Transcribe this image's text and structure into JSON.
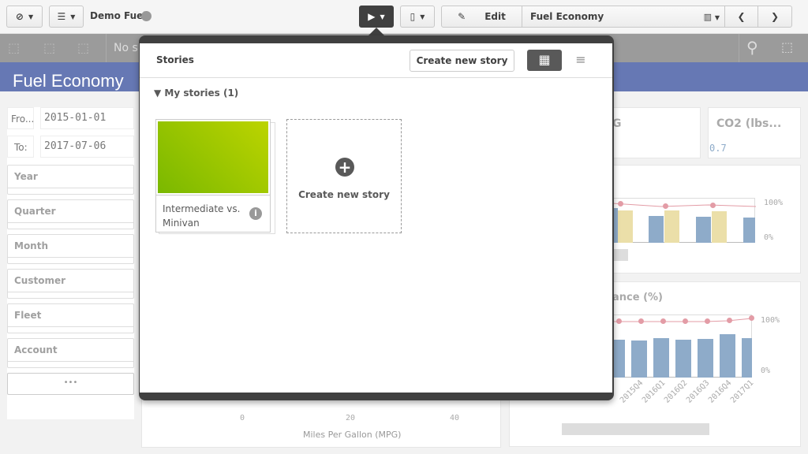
{
  "toolbar": {
    "app_name": "Demo Fuel",
    "edit_label": "Edit",
    "sheet_name": "Fuel Economy"
  },
  "selections": {
    "text": "No s"
  },
  "sheet": {
    "title": "Fuel Economy"
  },
  "filters": {
    "from_label": "Fro...",
    "from_value": "2015-01-01",
    "to_label": "To:",
    "to_value": "2017-07-06",
    "items": [
      "Year",
      "Quarter",
      "Month",
      "Customer",
      "Fleet",
      "Account"
    ],
    "more": "•••"
  },
  "kpis": [
    {
      "title": "G"
    },
    {
      "title": "CO2 (lbs...",
      "value": "0.7"
    }
  ],
  "chart1": {
    "y_labels": [
      "100%",
      "0%"
    ]
  },
  "chart2": {
    "title": "ance (%)",
    "y_labels": [
      "100%",
      "0%"
    ],
    "x_labels": [
      "2015Q4",
      "2016Q1",
      "2016Q2",
      "2016Q3",
      "2016Q4",
      "2017Q1"
    ]
  },
  "chart3": {
    "x_ticks": [
      "0",
      "20",
      "40"
    ],
    "xlabel": "Miles Per Gallon (MPG)"
  },
  "stories": {
    "title": "Stories",
    "create_button": "Create new story",
    "section": "My stories (1)",
    "items": [
      {
        "title": "Intermediate vs. Minivan"
      }
    ],
    "create_tile": "Create new story"
  },
  "colors": {
    "accent": "#6678b4",
    "bar_blue": "#8eabc9",
    "bar_yellow": "#ebdfa9",
    "line": "#e39ca6",
    "story_thumb_from": "#7ab800",
    "story_thumb_to": "#bcd400"
  }
}
